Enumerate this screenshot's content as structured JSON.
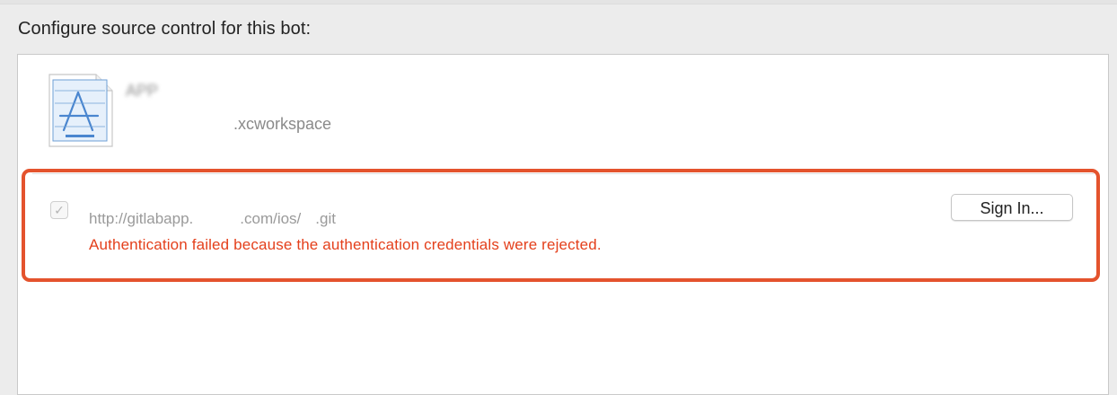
{
  "heading": "Configure source control for this bot:",
  "workspace": {
    "name": "APP",
    "filename": ".xcworkspace",
    "icon": "xcworkspace-document-icon"
  },
  "repository": {
    "checked": true,
    "check_glyph": "✓",
    "name": "",
    "url_prefix": "http://gitlabapp.",
    "url_middle": ".com/ios/",
    "url_suffix": ".git",
    "error": "Authentication failed because the authentication credentials were rejected.",
    "highlight_color": "#e4532d",
    "error_color": "#e4401c"
  },
  "sign_in_button": {
    "label": "Sign In..."
  }
}
